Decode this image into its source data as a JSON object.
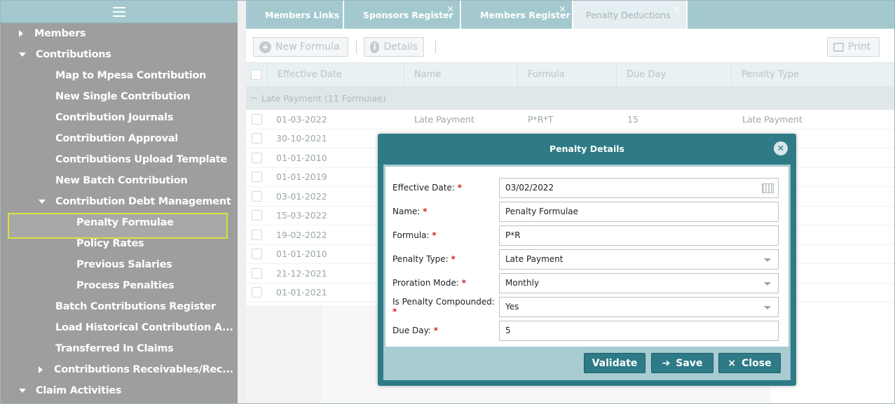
{
  "sidebar": {
    "items": [
      {
        "label": "Members"
      },
      {
        "label": "Contributions"
      },
      {
        "label": "Map to Mpesa Contribution"
      },
      {
        "label": "New Single Contribution"
      },
      {
        "label": "Contribution Journals"
      },
      {
        "label": "Contribution Approval"
      },
      {
        "label": "Contributions Upload Template"
      },
      {
        "label": "New Batch Contribution"
      },
      {
        "label": "Contribution Debt Management"
      },
      {
        "label": "Penalty Formulae"
      },
      {
        "label": "Policy Rates"
      },
      {
        "label": "Previous Salaries"
      },
      {
        "label": "Process Penalties"
      },
      {
        "label": "Batch Contributions Register"
      },
      {
        "label": "Load Historical Contribution A..."
      },
      {
        "label": "Transferred In Claims"
      },
      {
        "label": "Contributions Receivables/Rec..."
      },
      {
        "label": "Claim Activities"
      }
    ]
  },
  "tabs": [
    {
      "label": "Members Links"
    },
    {
      "label": "Sponsors Register"
    },
    {
      "label": "Members Register"
    },
    {
      "label": "Penalty Deductions"
    }
  ],
  "toolbar": {
    "new_formula": "New Formula",
    "details": "Details",
    "print": "Print"
  },
  "grid": {
    "columns": [
      "Effective Date",
      "Name",
      "Formula",
      "Due Day",
      "Penalty Type"
    ],
    "group_label": "Late Payment (11 Formulae)",
    "rows": [
      {
        "date": "01-03-2022",
        "name": "Late Payment",
        "formula": "P*R*T",
        "due": "15",
        "type": "Late Payment"
      },
      {
        "date": "30-10-2021"
      },
      {
        "date": "01-01-2010"
      },
      {
        "date": "01-01-2019"
      },
      {
        "date": "03-01-2022"
      },
      {
        "date": "15-03-2022"
      },
      {
        "date": "19-02-2022"
      },
      {
        "date": "01-01-2010"
      },
      {
        "date": "21-12-2021"
      },
      {
        "date": "01-01-2021"
      }
    ]
  },
  "dialog": {
    "title": "Penalty Details",
    "fields": [
      {
        "label": "Effective Date:",
        "value": "03/02/2022"
      },
      {
        "label": "Name:",
        "value": "Penalty Formulae"
      },
      {
        "label": "Formula:",
        "value": "P*R"
      },
      {
        "label": "Penalty Type:",
        "value": "Late Payment"
      },
      {
        "label": "Proration Mode:",
        "value": "Monthly"
      },
      {
        "label": "Is Penalty Compounded:",
        "value": "Yes"
      },
      {
        "label": "Due Day:",
        "value": "5"
      }
    ],
    "required_mark": "*",
    "buttons": {
      "validate": "Validate",
      "save": "Save",
      "close": "Close"
    }
  },
  "icons": {
    "close_glyph": "×",
    "circle_x": "✕"
  }
}
